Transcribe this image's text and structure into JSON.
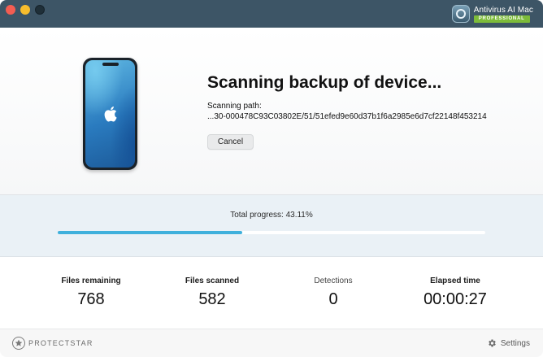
{
  "window": {
    "brand_name": "Antivirus AI Mac",
    "brand_badge": "PROFESSIONAL"
  },
  "scan": {
    "title": "Scanning backup of device...",
    "path_label": "Scanning path:",
    "path_value": "...30-000478C93C03802E/51/51efed9e60d37b1f6a2985e6d7cf22148f453214",
    "cancel_label": "Cancel"
  },
  "progress": {
    "label": "Total progress: 43.11%",
    "percent": 43.11
  },
  "stats": [
    {
      "label": "Files remaining",
      "value": "768"
    },
    {
      "label": "Files scanned",
      "value": "582"
    },
    {
      "label": "Detections",
      "value": "0"
    },
    {
      "label": "Elapsed time",
      "value": "00:00:27"
    }
  ],
  "footer": {
    "logo_text": "PROTECTSTAR",
    "settings_label": "Settings"
  },
  "colors": {
    "titlebar": "#3d5566",
    "accent": "#3fb0dc",
    "badge": "#7dbb3a"
  },
  "icons": {
    "phone": "apple-logo-icon",
    "settings": "gear-icon",
    "brand": "shield-icon",
    "footer_logo": "star-icon"
  }
}
